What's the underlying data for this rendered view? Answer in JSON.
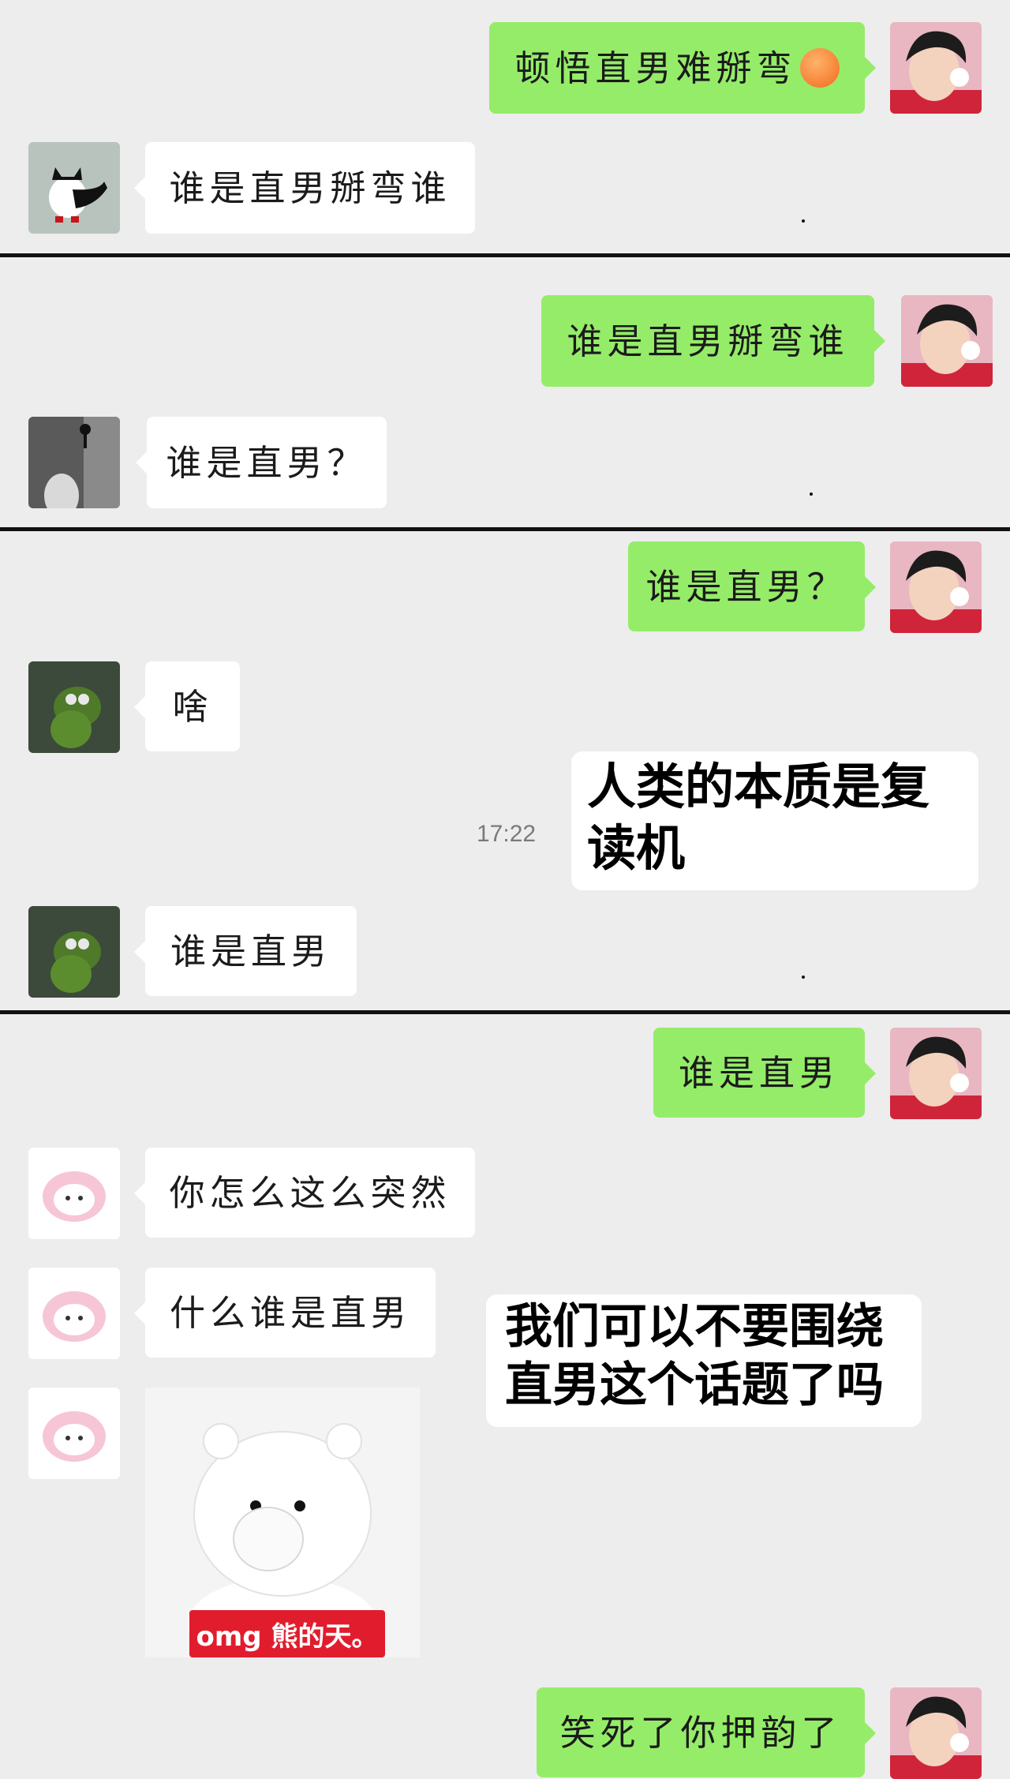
{
  "messages": {
    "m1": "顿悟直男难掰弯",
    "m2": "谁是直男掰弯谁",
    "m3": "谁是直男掰弯谁",
    "m4": "谁是直男？",
    "m5": "谁是直男？",
    "m6": "啥",
    "m7": "谁是直男",
    "m8": "谁是直男",
    "m9": "你怎么这么突然",
    "m10": "什么谁是直男",
    "m11": "笑死了你押韵了"
  },
  "timestamp": "17:22",
  "captions": {
    "c1_line1": "人类的本质是复",
    "c1_line2": "读机",
    "c2_line1": "我们可以不要围绕",
    "c2_line2": "直男这个话题了吗"
  },
  "sticker": {
    "label": "omg 熊的天。"
  },
  "icons": {
    "self_avatar": "boy-avatar",
    "cat_avatar": "cat-avatar",
    "photo_avatar": "man-photo-avatar",
    "frog_avatar": "kermit-avatar",
    "melody_avatar": "melody-avatar",
    "emoji": "sweat-face-emoji"
  },
  "colors": {
    "background": "#ededed",
    "green_bubble": "#95ec69",
    "white_bubble": "#ffffff"
  }
}
